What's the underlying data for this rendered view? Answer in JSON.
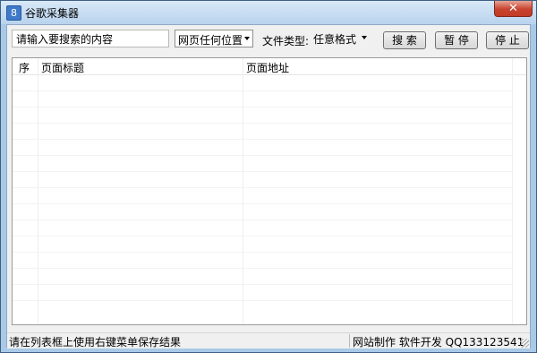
{
  "window": {
    "title": "谷歌采集器",
    "app_icon": "8"
  },
  "toolbar": {
    "search_value": "请输入要搜索的内容",
    "position_select": "网页任何位置",
    "file_type_label": "文件类型:",
    "file_type_select": "任意格式",
    "search_button": "搜 索",
    "pause_button": "暂 停",
    "stop_button": "停 止"
  },
  "list": {
    "columns": [
      "序",
      "页面标题",
      "页面地址"
    ]
  },
  "status": {
    "left": "请在列表框上使用右键菜单保存结果",
    "right": "网站制作 软件开发 QQ133123541"
  },
  "colors": {
    "titlebar": "#c5dbf1",
    "close": "#c7432f"
  }
}
